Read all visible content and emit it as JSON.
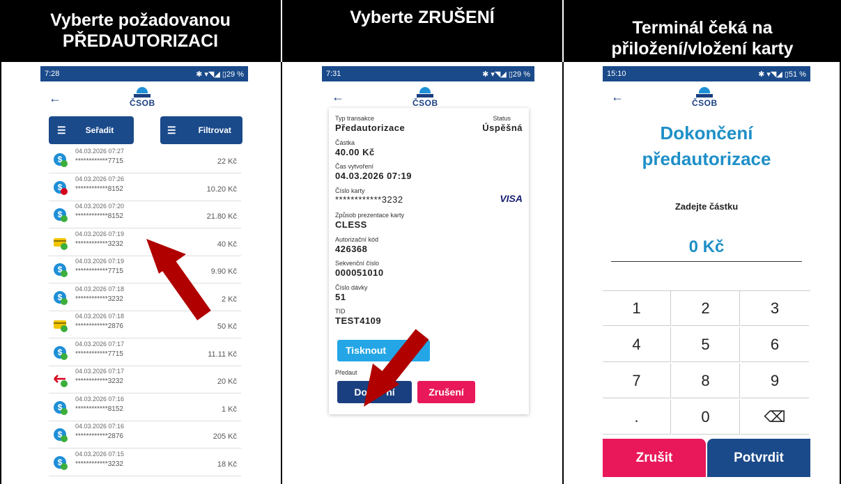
{
  "headers": [
    "Vyberte požadovanou PŘEDAUTORIZACI",
    "Vyberte ZRUŠENÍ",
    "Terminál čeká na přiložení/vložení karty"
  ],
  "phone1": {
    "time": "7:28",
    "status_icons": "✱ ▾◥◢ ▯29 %",
    "logo": "ČSOB",
    "sort_label": "Seřadit",
    "filter_label": "Filtrovat",
    "transactions": [
      {
        "date": "04.03.2026 07:27",
        "card": "************7715",
        "amount": "22 Kč",
        "icon": "green-check"
      },
      {
        "date": "04.03.2026 07:26",
        "card": "************8152",
        "amount": "10.20 Kč",
        "icon": "red-error"
      },
      {
        "date": "04.03.2026 07:20",
        "card": "************8152",
        "amount": "21.80 Kč",
        "icon": "green-check"
      },
      {
        "date": "04.03.2026 07:19",
        "card": "************3232",
        "amount": "40 Kč",
        "icon": "yellow-card"
      },
      {
        "date": "04.03.2026 07:19",
        "card": "************7715",
        "amount": "9.90 Kč",
        "icon": "green-check"
      },
      {
        "date": "04.03.2026 07:18",
        "card": "************3232",
        "amount": "2 Kč",
        "icon": "green-check"
      },
      {
        "date": "04.03.2026 07:18",
        "card": "************2876",
        "amount": "50 Kč",
        "icon": "yellow-card"
      },
      {
        "date": "04.03.2026 07:17",
        "card": "************7715",
        "amount": "11.11 Kč",
        "icon": "green-check"
      },
      {
        "date": "04.03.2026 07:17",
        "card": "************3232",
        "amount": "20 Kč",
        "icon": "refund-arrow"
      },
      {
        "date": "04.03.2026 07:16",
        "card": "************8152",
        "amount": "1 Kč",
        "icon": "green-check"
      },
      {
        "date": "04.03.2026 07:16",
        "card": "************2876",
        "amount": "205 Kč",
        "icon": "green-check"
      },
      {
        "date": "04.03.2026 07:15",
        "card": "************3232",
        "amount": "18 Kč",
        "icon": "green-check"
      }
    ]
  },
  "phone2": {
    "time": "7:31",
    "status_icons": "✱ ▾◥◢ ▯29 %",
    "logo": "ČSOB",
    "type_label": "Typ transakce",
    "type_value": "Předautorizace",
    "status_label": "Status",
    "status_value": "Úspěšná",
    "amount_label": "Částka",
    "amount_value": "40.00 Kč",
    "created_label": "Čas vytvoření",
    "created_value": "04.03.2026 07:19",
    "card_label": "Číslo karty",
    "card_value": "************3232",
    "card_brand": "VISA",
    "method_label": "Způsob prezentace karty",
    "method_value": "CLESS",
    "auth_label": "Autorizační kód",
    "auth_value": "426368",
    "seq_label": "Sekvenční číslo",
    "seq_value": "000051010",
    "batch_label": "Číslo dávky",
    "batch_value": "51",
    "tid_label": "TID",
    "tid_value": "TEST4109",
    "print_button": "Tisknout",
    "preauth_label": "Předaut",
    "complete_button": "Dok     ní",
    "cancel_button": "Zrušení"
  },
  "phone3": {
    "time": "15:10",
    "status_icons": "✱ ▾◥◢ ▯51 %",
    "logo": "ČSOB",
    "title": "Dokončení předautorizace",
    "prompt": "Zadejte částku",
    "amount": "0 Kč",
    "keys": [
      "1",
      "2",
      "3",
      "4",
      "5",
      "6",
      "7",
      "8",
      "9",
      ".",
      "0",
      "⌫"
    ],
    "cancel": "Zrušit",
    "confirm": "Potvrdit"
  },
  "colors": {
    "header_bg": "#000000",
    "csob_blue": "#1a4a8a",
    "csob_light": "#1e90d6",
    "pink": "#e8185a",
    "arrow_red": "#b00000",
    "title_cyan": "#1e8fc7"
  }
}
